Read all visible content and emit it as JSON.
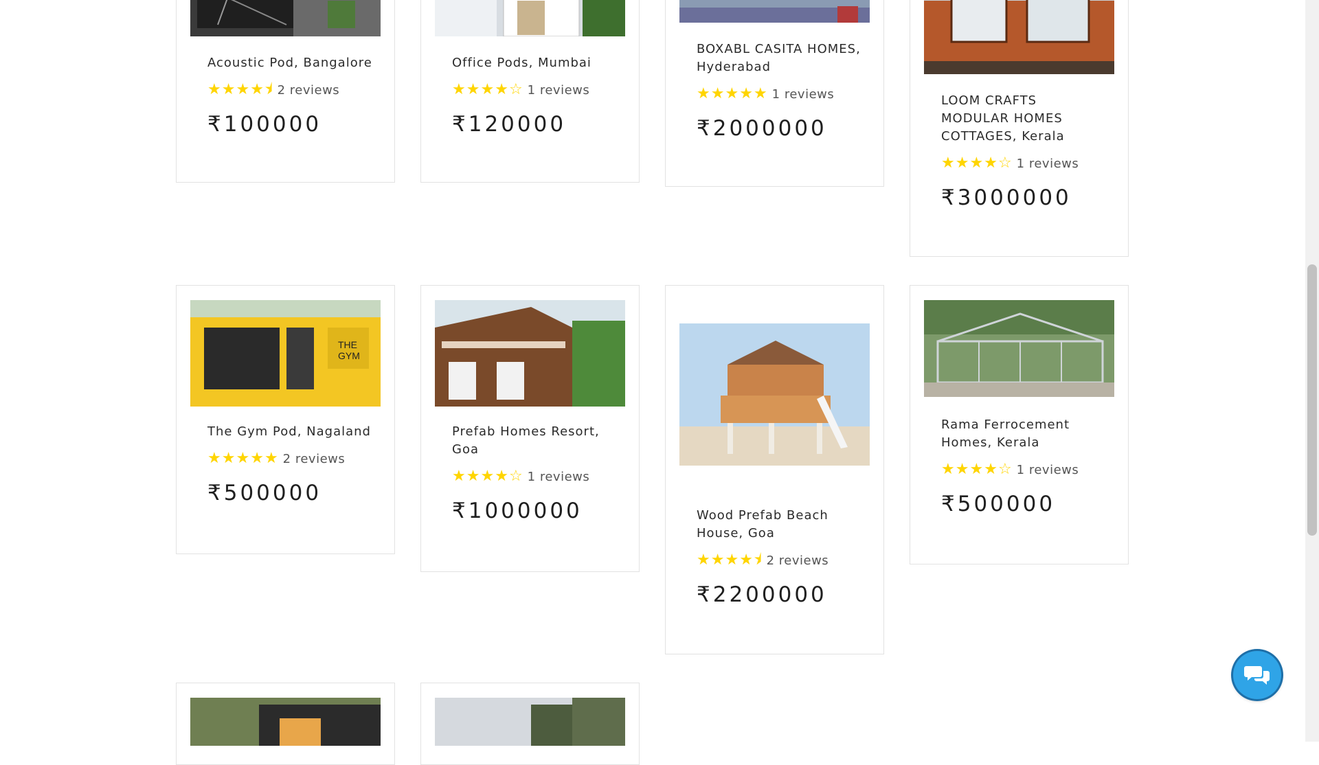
{
  "listings": [
    {
      "title": "Acoustic Pod, Bangalore",
      "stars": 4.5,
      "reviews": "2 reviews",
      "price": "₹100000"
    },
    {
      "title": "Office Pods, Mumbai",
      "stars": 4,
      "reviews": "1 reviews",
      "price": "₹120000"
    },
    {
      "title": "BOXABL CASITA HOMES, Hyderabad",
      "stars": 5,
      "reviews": "1 reviews",
      "price": "₹2000000"
    },
    {
      "title": "LOOM CRAFTS MODULAR HOMES COTTAGES, Kerala",
      "stars": 4,
      "reviews": "1 reviews",
      "price": "₹3000000"
    },
    {
      "title": "The Gym Pod, Nagaland",
      "stars": 5,
      "reviews": "2 reviews",
      "price": "₹500000"
    },
    {
      "title": "Prefab Homes Resort, Goa",
      "stars": 4,
      "reviews": "1 reviews",
      "price": "₹1000000"
    },
    {
      "title": "Wood Prefab Beach House, Goa",
      "stars": 4.5,
      "reviews": "2 reviews",
      "price": "₹2200000"
    },
    {
      "title": "Rama Ferrocement Homes, Kerala",
      "stars": 4,
      "reviews": "1 reviews",
      "price": "₹500000"
    }
  ],
  "icons": {
    "chat": "chat-bubbles-icon",
    "star": "star-icon"
  },
  "colors": {
    "star": "#ffd500",
    "chat_button": "#2fa4e7"
  }
}
